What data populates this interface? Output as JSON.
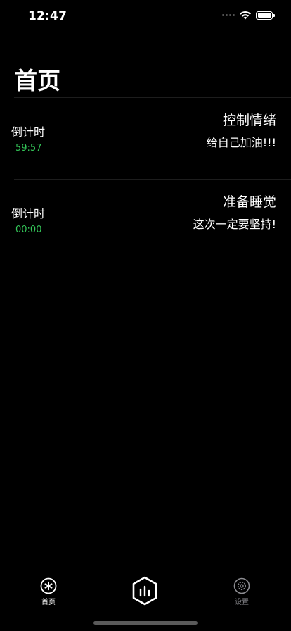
{
  "status_bar": {
    "time": "12:47"
  },
  "page": {
    "title": "首页"
  },
  "tasks": [
    {
      "countdown_label": "倒计时",
      "countdown_value": "59:57",
      "name": "控制情绪",
      "motto": "给自己加油!!!"
    },
    {
      "countdown_label": "倒计时",
      "countdown_value": "00:00",
      "name": "准备睡觉",
      "motto": "这次一定要坚持!"
    }
  ],
  "tab_bar": {
    "home_label": "首页",
    "settings_label": "设置",
    "home_icon": "asterisk-circle-icon",
    "center_icon": "hexagon-chart-icon",
    "settings_icon": "gear-circle-icon"
  },
  "colors": {
    "background": "#000000",
    "countdown_green": "#34c759",
    "inactive_tab": "#8e8e93"
  }
}
